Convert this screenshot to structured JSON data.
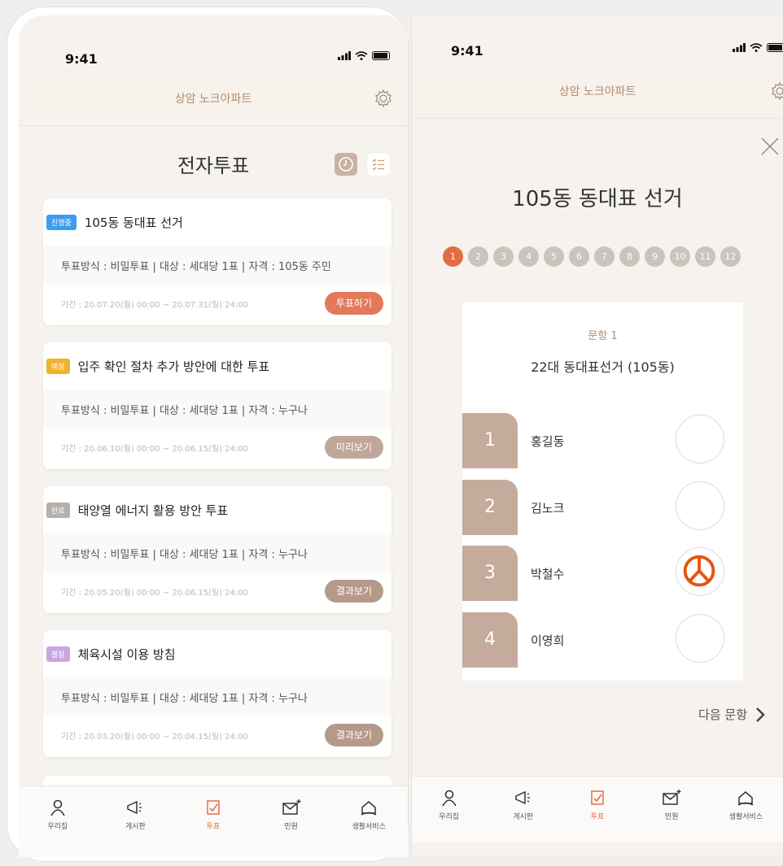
{
  "status": {
    "time": "9:41"
  },
  "header": {
    "title": "상암 노크아파트"
  },
  "left": {
    "page_title": "전자투표",
    "cards": [
      {
        "badge": "진행중",
        "badge_color": "#3d9cf0",
        "title": "105동 동대표 선거",
        "meta": "투표방식 : 비밀투표  |  대상 : 세대당 1표  |  자격 : 105동 주민",
        "period": "기간 : 20.07.20(월) 00:00 ~ 20.07.31(일) 24:00",
        "action": "투표하기",
        "action_color": "#e4785a"
      },
      {
        "badge": "예정",
        "badge_color": "#f0b22d",
        "title": "입주 확인 절차 추가 방안에 대한 투표",
        "meta": "투표방식 : 비밀투표  |  대상 : 세대당 1표  |  자격 : 누구나",
        "period": "기간 : 20.06.10(월) 00:00 ~ 20.06.15(일) 24:00",
        "action": "미리보기",
        "action_color": "#c0a79a"
      },
      {
        "badge": "완료",
        "badge_color": "#b5b0ab",
        "title": "태양열 에너지 활용 방안 투표",
        "meta": "투표방식 : 비밀투표  |  대상 : 세대당 1표  |  자격 : 누구나",
        "period": "기간 : 20.05.20(월) 00:00 ~ 20.06.15(일) 24:00",
        "action": "결과보기",
        "action_color": "#b59a8a"
      },
      {
        "badge": "불참",
        "badge_color": "#c9a6e3",
        "title": "체육시설 이용 방침",
        "meta": "투표방식 : 비밀투표  |  대상 : 세대당 1표  |  자격 : 누구나",
        "period": "기간 : 20.03.20(월) 00:00 ~ 20.04.15(일) 24:00",
        "action": "결과보기",
        "action_color": "#b59a8a"
      }
    ]
  },
  "nav": [
    {
      "label": "우리집",
      "icon": "person-icon"
    },
    {
      "label": "게시판",
      "icon": "megaphone-icon"
    },
    {
      "label": "투표",
      "icon": "vote-icon"
    },
    {
      "label": "민원",
      "icon": "mail-plus-icon"
    },
    {
      "label": "생활서비스",
      "icon": "home-hand-icon"
    }
  ],
  "right": {
    "election_title": "105동 동대표 선거",
    "steps": [
      "1",
      "2",
      "3",
      "4",
      "5",
      "6",
      "7",
      "8",
      "9",
      "10",
      "11",
      "12"
    ],
    "question_no": "문항 1",
    "question_text": "22대 동대표선거 (105동)",
    "candidates": [
      {
        "num": "1",
        "name": "홍길동",
        "selected": false
      },
      {
        "num": "2",
        "name": "김노크",
        "selected": false
      },
      {
        "num": "3",
        "name": "박철수",
        "selected": true
      },
      {
        "num": "4",
        "name": "이영희",
        "selected": false
      }
    ],
    "next_label": "다음 문항"
  },
  "colors": {
    "accent": "#e36c43",
    "brand": "#b28b6e"
  }
}
